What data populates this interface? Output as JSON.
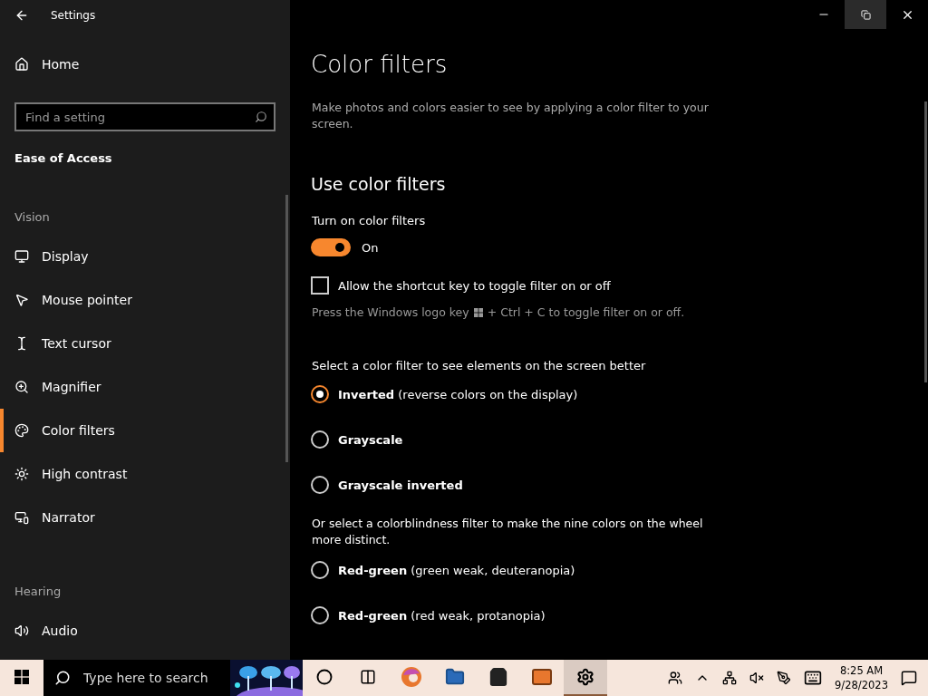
{
  "window": {
    "title": "Settings"
  },
  "sidebar": {
    "home": "Home",
    "search": {
      "placeholder": "Find a setting"
    },
    "category": "Ease of Access",
    "sections": [
      {
        "heading": "Vision",
        "items": [
          {
            "label": "Display",
            "selected": false
          },
          {
            "label": "Mouse pointer",
            "selected": false
          },
          {
            "label": "Text cursor",
            "selected": false
          },
          {
            "label": "Magnifier",
            "selected": false
          },
          {
            "label": "Color filters",
            "selected": true
          },
          {
            "label": "High contrast",
            "selected": false
          },
          {
            "label": "Narrator",
            "selected": false
          }
        ]
      },
      {
        "heading": "Hearing",
        "items": [
          {
            "label": "Audio",
            "selected": false
          }
        ]
      }
    ]
  },
  "main": {
    "title": "Color filters",
    "description": "Make photos and colors easier to see by applying a color filter to your screen.",
    "section": "Use color filters",
    "toggle": {
      "label": "Turn on color filters",
      "on": true,
      "state_text": "On"
    },
    "shortcut": {
      "label": "Allow the shortcut key to toggle filter on or off",
      "checked": false
    },
    "hint_before": "Press the Windows logo key",
    "hint_after": "+ Ctrl + C to toggle filter on or off.",
    "filter_prompt": "Select a color filter to see elements on the screen better",
    "filters": [
      {
        "label": "**Inverted** (reverse colors on the display)",
        "selected": true
      },
      {
        "label": "**Grayscale**",
        "selected": false
      },
      {
        "label": "**Grayscale inverted**",
        "selected": false
      }
    ],
    "colorblind_prompt": "Or select a colorblindness filter to make the nine colors on the wheel more distinct.",
    "colorblind_filters": [
      {
        "label": "**Red-green** (green weak, deuteranopia)",
        "selected": false
      },
      {
        "label": "**Red-green** (red weak, protanopia)",
        "selected": false
      }
    ]
  },
  "taskbar": {
    "search": {
      "placeholder": "Type here to search"
    },
    "apps": [
      {
        "kind": "cortana",
        "active": false
      },
      {
        "kind": "taskview",
        "active": false
      },
      {
        "kind": "edge",
        "active": false
      },
      {
        "kind": "explorer",
        "active": false
      },
      {
        "kind": "store",
        "active": false
      },
      {
        "kind": "mail",
        "active": false
      },
      {
        "kind": "settings",
        "active": true
      }
    ],
    "time": "8:25 AM",
    "date": "9/28/2023"
  }
}
